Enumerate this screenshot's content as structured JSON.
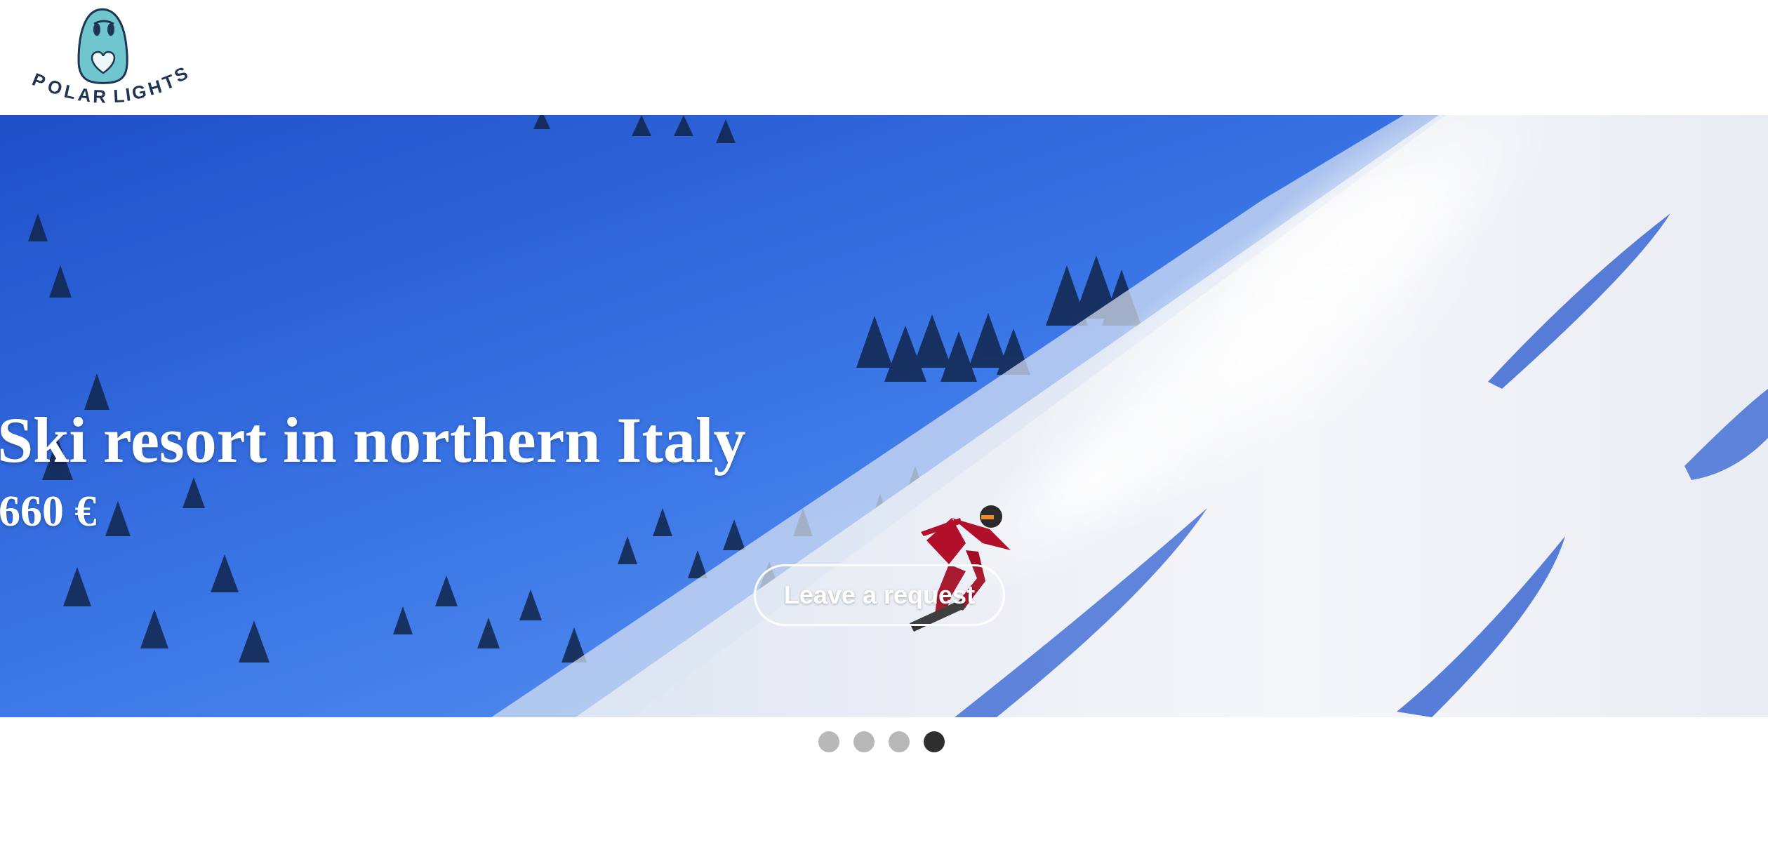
{
  "brand": {
    "name": "POLAR LIGHTS",
    "colors": {
      "logo_teal": "#6fc6cf",
      "logo_navy": "#1f3553"
    }
  },
  "hero": {
    "title": "Ski resort in northern Italy",
    "price": "660 €",
    "cta_label": "Leave a request",
    "image": "snowboarder-on-powder-slope"
  },
  "carousel": {
    "slide_count": 4,
    "active_index": 3,
    "colors": {
      "inactive": "#b8b8b8",
      "active": "#2e2e2e"
    }
  }
}
